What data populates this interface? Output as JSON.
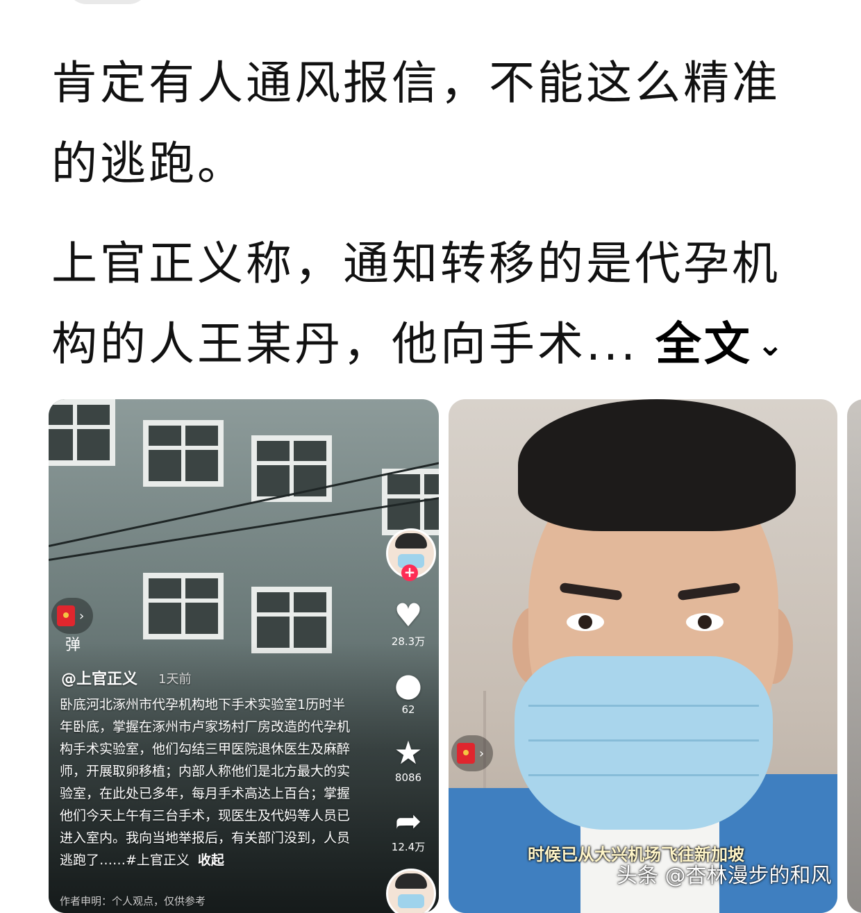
{
  "post": {
    "paragraph1": "肯定有人通风报信，不能这么精准的逃跑。",
    "paragraph2": "上官正义称，通知转移的是代孕机构的人王某丹，他向手术...",
    "expand_label": "全文"
  },
  "video1": {
    "danmu_label": "弹",
    "username": "@上官正义",
    "time_ago": "1天前",
    "caption": "卧底河北涿州市代孕机构地下手术实验室1历时半年卧底，掌握在涿州市卢家场村厂房改造的代孕机构手术实验室，他们勾结三甲医院退休医生及麻醉师，开展取卵移植；内部人称他们是北方最大的实验室，在此处已多年，每月手术高达上百台；掌握他们今天上午有三台手术，现医生及代妈等人员已进入室内。我向当地举报后，有关部门没到，人员逃跑了……#上官正义",
    "collapse_label": "收起",
    "footer_text": "作者申明：个人观点，仅供参考",
    "likes": "28.3万",
    "comments": "62",
    "favorites": "8086",
    "shares": "12.4万"
  },
  "video2": {
    "subtitle": "时候已从大兴机场飞往新加坡"
  },
  "watermark": "头条 @杏林漫步的和风",
  "colors": {
    "follow_badge": "#fe2c55",
    "red_envelope": "#e0262e"
  },
  "icons": [
    "heart-icon",
    "comment-icon",
    "star-icon",
    "share-icon",
    "red-envelope-icon",
    "chevron-down-icon"
  ]
}
